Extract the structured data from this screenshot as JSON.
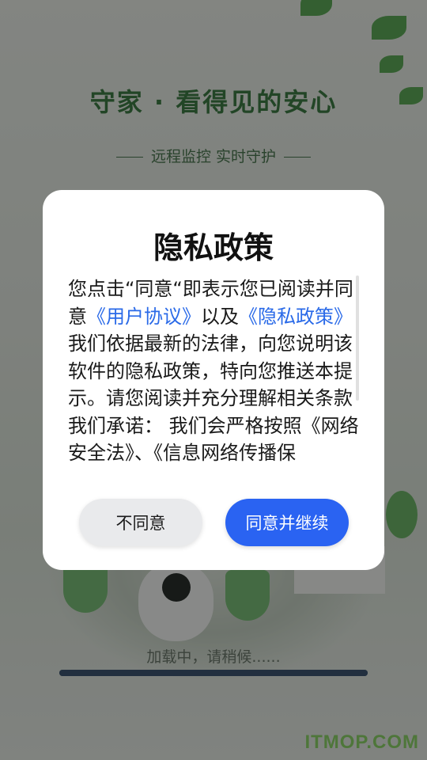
{
  "splash": {
    "title": "守家 · 看得见的安心",
    "subtitle": "远程监控  实时守护",
    "loading_text": "加载中，请稍候......",
    "loading_progress": 1.0,
    "watermark": "ITMOP.COM"
  },
  "dialog": {
    "title": "隐私政策",
    "body_part1": "您点击“同意“即表示您已阅读并同意",
    "link_user_agreement": "《用户协议》",
    "body_part2": "以及",
    "link_privacy_policy": "《隐私政策》",
    "body_part3": "我们依据最新的法律，向您说明该软件的隐私政策，特向您推送本提示。请您阅读并充分理解相关条款我们承诺： 我们会严格按照《网络安全法》、《信息网络传播保",
    "decline_label": "不同意",
    "accept_label": "同意并继续"
  },
  "colors": {
    "accent": "#2a63f2",
    "link": "#2a6ae8",
    "brand_green": "#3f7f45"
  }
}
